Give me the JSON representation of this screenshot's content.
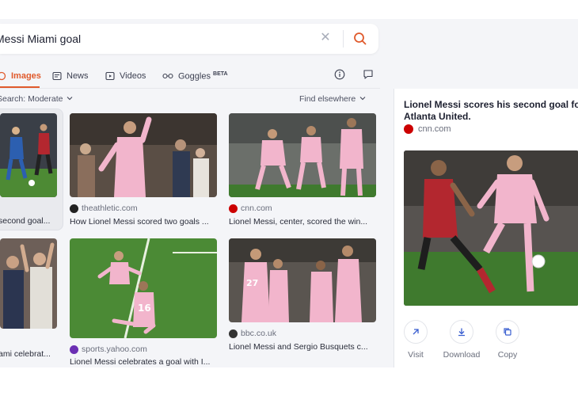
{
  "search": {
    "query": "Messi Miami goal",
    "clear_icon": "close-icon",
    "submit_icon": "search-icon"
  },
  "tabs": [
    {
      "label": "Images",
      "icon": "image-icon",
      "active": true
    },
    {
      "label": "News",
      "icon": "news-icon",
      "active": false
    },
    {
      "label": "Videos",
      "icon": "video-icon",
      "active": false
    },
    {
      "label": "Goggles",
      "badge": "BETA",
      "icon": "goggles-icon",
      "active": false
    }
  ],
  "filters": {
    "safe_search": "Search: Moderate",
    "find_elsewhere": "Find elsewhere"
  },
  "results": [
    {
      "source": "",
      "caption": "second goal...",
      "selected": true
    },
    {
      "source": "theathletic.com",
      "caption": "How Lionel Messi scored two goals ..."
    },
    {
      "source": "cnn.com",
      "caption": "Lionel Messi, center, scored the win..."
    },
    {
      "source": "",
      "caption": "ami celebrat..."
    },
    {
      "source": "sports.yahoo.com",
      "caption": "Lionel Messi celebrates a goal with I..."
    },
    {
      "source": "bbc.co.uk",
      "caption": "Lionel Messi and Sergio Busquets c..."
    }
  ],
  "detail": {
    "title": "Lionel Messi scores his second goal for Atlanta United.",
    "source": "cnn.com",
    "actions": [
      "Visit",
      "Download",
      "Copy"
    ]
  },
  "colors": {
    "accent": "#e05a2c",
    "pink_kit": "#f2b5cc",
    "pitch": "#3f7a2e"
  }
}
